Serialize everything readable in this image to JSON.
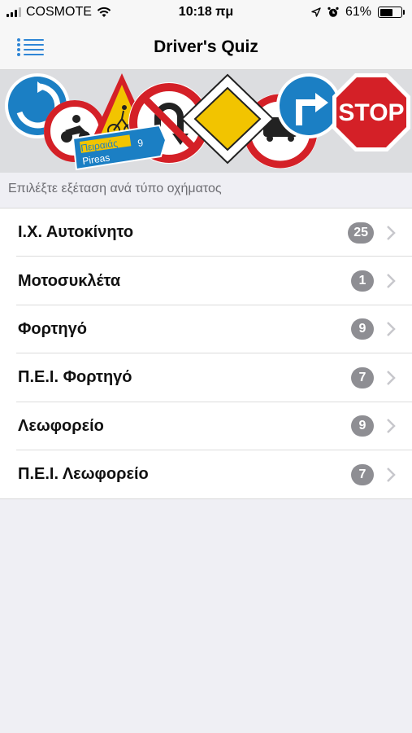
{
  "status": {
    "carrier": "COSMOTE",
    "time": "10:18 πμ",
    "battery": "61%",
    "battery_level": 0.61
  },
  "nav": {
    "title": "Driver's Quiz"
  },
  "banner": {
    "sign_text_stop": "STOP",
    "sign_text_pireas_gr": "Πειραιάς",
    "sign_text_pireas_en": "Pireas",
    "sign_text_number": "9"
  },
  "section": {
    "header": "Επιλέξτε εξέταση ανά τύπο οχήματος"
  },
  "list": [
    {
      "label": "Ι.Χ. Αυτοκίνητο",
      "count": "25"
    },
    {
      "label": "Μοτοσυκλέτα",
      "count": "1"
    },
    {
      "label": "Φορτηγό",
      "count": "9"
    },
    {
      "label": "Π.Ε.Ι. Φορτηγό",
      "count": "7"
    },
    {
      "label": "Λεωφορείο",
      "count": "9"
    },
    {
      "label": "Π.Ε.Ι. Λεωφορείο",
      "count": "7"
    }
  ],
  "colors": {
    "accent": "#2f86d6",
    "badge": "#8e8e93",
    "background": "#efeff4",
    "sign_red": "#d42027",
    "sign_blue": "#1b7fc4"
  }
}
